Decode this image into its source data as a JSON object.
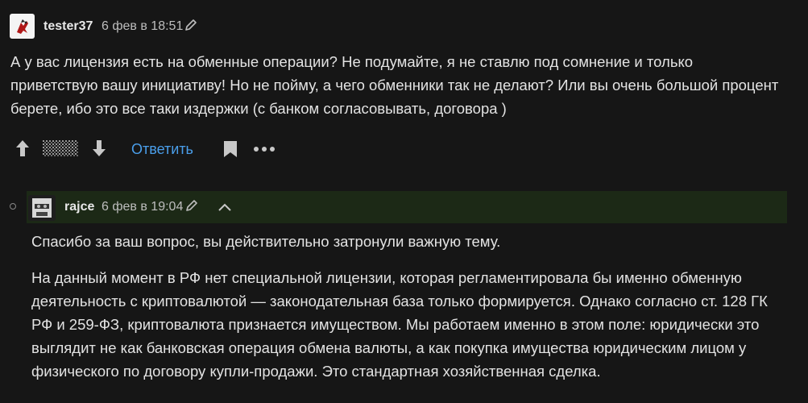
{
  "comment": {
    "username": "tester37",
    "timestamp": "6 фев в 18:51",
    "avatar_icon": "avatar-icon",
    "text": "А у вас лицензия есть на обменные операции? Не подумайте, я не ставлю под сомнение и только приветствую вашу инициативу! Но не пойму, а чего обменники так не делают? Или вы очень большой процент берете, ибо это все таки издержки (с банком согласовывать, договора )",
    "actions": {
      "reply_label": "Ответить",
      "upvote_icon": "arrow-up-icon",
      "downvote_icon": "arrow-down-icon",
      "bookmark_icon": "bookmark-icon",
      "more_icon": "more-icon"
    }
  },
  "reply": {
    "username": "rajce",
    "timestamp": "6 фев в 19:04",
    "paragraph1": "Спасибо за ваш вопрос, вы действительно затронули важную тему.",
    "paragraph2": "На данный момент в РФ нет специальной лицензии, которая регламентировала бы именно обменную деятельность с криптовалютой — законодательная база только формируется. Однако согласно ст. 128 ГК РФ и 259-ФЗ, криптовалюта признается имуществом. Мы работаем именно в этом поле: юридически это выглядит не как банковская операция обмена валюты, а как покупка имущества юридическим лицом у физического по договору купли-продажи. Это стандартная хозяйственная сделка."
  },
  "colors": {
    "background": "#161616",
    "reply_header_bg": "#1c2916",
    "link": "#4a9eea"
  }
}
